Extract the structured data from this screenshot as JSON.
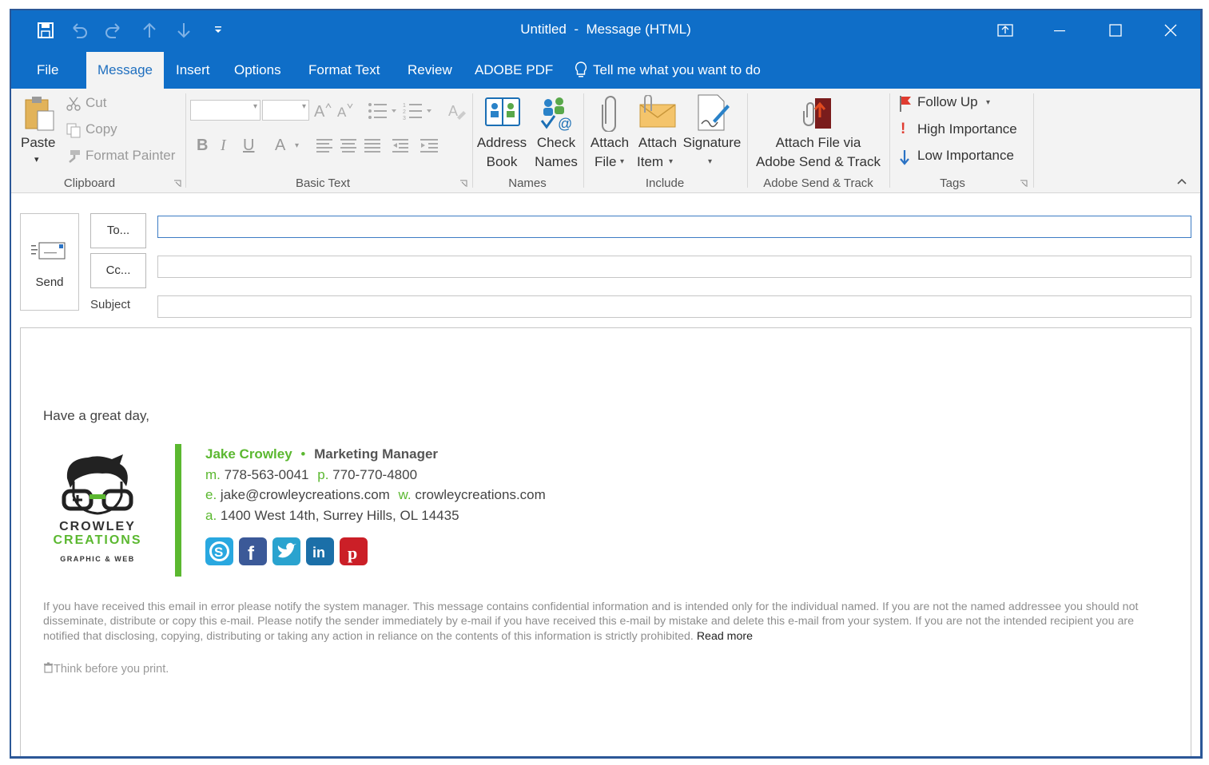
{
  "window": {
    "title": "Untitled  -  Message (HTML)",
    "accent_color": "#0f6ec8"
  },
  "quick_access": [
    "save-icon",
    "undo-icon",
    "redo-icon",
    "up-arrow-icon",
    "down-arrow-icon",
    "customize-dropdown-icon"
  ],
  "tabs": [
    {
      "label": "File"
    },
    {
      "label": "Message"
    },
    {
      "label": "Insert"
    },
    {
      "label": "Options"
    },
    {
      "label": "Format Text"
    },
    {
      "label": "Review"
    },
    {
      "label": "ADOBE PDF"
    }
  ],
  "tell_me": "Tell me what you want to do",
  "ribbon": {
    "clipboard": {
      "label": "Clipboard",
      "paste": "Paste",
      "cut": "Cut",
      "copy": "Copy",
      "format_painter": "Format Painter"
    },
    "basic_text": {
      "label": "Basic Text",
      "bold": "B",
      "italic": "I",
      "underline": "U",
      "font_color": "A"
    },
    "names": {
      "label": "Names",
      "address_book_1": "Address",
      "address_book_2": "Book",
      "check_names_1": "Check",
      "check_names_2": "Names"
    },
    "include": {
      "label": "Include",
      "attach_file_1": "Attach",
      "attach_file_2": "File",
      "attach_item_1": "Attach",
      "attach_item_2": "Item",
      "signature": "Signature"
    },
    "adobe": {
      "label": "Adobe Send & Track",
      "attach_1": "Attach File via",
      "attach_2": "Adobe Send & Track"
    },
    "tags": {
      "label": "Tags",
      "follow_up": "Follow Up",
      "high": "High Importance",
      "low": "Low Importance"
    }
  },
  "compose": {
    "send": "Send",
    "to": "To...",
    "cc": "Cc...",
    "subject_label": "Subject",
    "to_value": "",
    "cc_value": "",
    "subject_value": ""
  },
  "body": {
    "greeting": "Have a great day,",
    "signature": {
      "name": "Jake Crowley",
      "bullet": "•",
      "title": "Marketing Manager",
      "m_label": "m.",
      "mobile": "778-563-0041",
      "p_label": "p.",
      "phone": "770-770-4800",
      "e_label": "e.",
      "email": "jake@crowleycreations.com",
      "w_label": "w.",
      "website": "crowleycreations.com",
      "a_label": "a.",
      "address": "1400 West 14th, Surrey Hills, OL 14435",
      "logo_line1": "CROWLEY",
      "logo_line2": "CREATIONS",
      "logo_line3": "GRAPHIC & WEB",
      "brand_color": "#5bb830",
      "social": [
        {
          "icon": "skype-icon",
          "color": "#29a8e0"
        },
        {
          "icon": "facebook-icon",
          "color": "#3b5998"
        },
        {
          "icon": "twitter-icon",
          "color": "#2aa3cf"
        },
        {
          "icon": "linkedin-icon",
          "color": "#1b6fa8"
        },
        {
          "icon": "pinterest-icon",
          "color": "#cb1f27"
        }
      ]
    },
    "disclaimer": "If you have received this email in error please notify the system manager. This message contains confidential information and is intended only for the individual named. If you are not the named addressee you should not disseminate, distribute or copy this e-mail. Please notify the sender immediately by e-mail if you have received this e-mail by mistake and delete this e-mail from your system. If you are not the intended recipient you are notified that disclosing, copying, distributing or taking any action in reliance on the contents of this information is strictly prohibited.",
    "read_more": "Read more",
    "think": "Think before you print."
  }
}
